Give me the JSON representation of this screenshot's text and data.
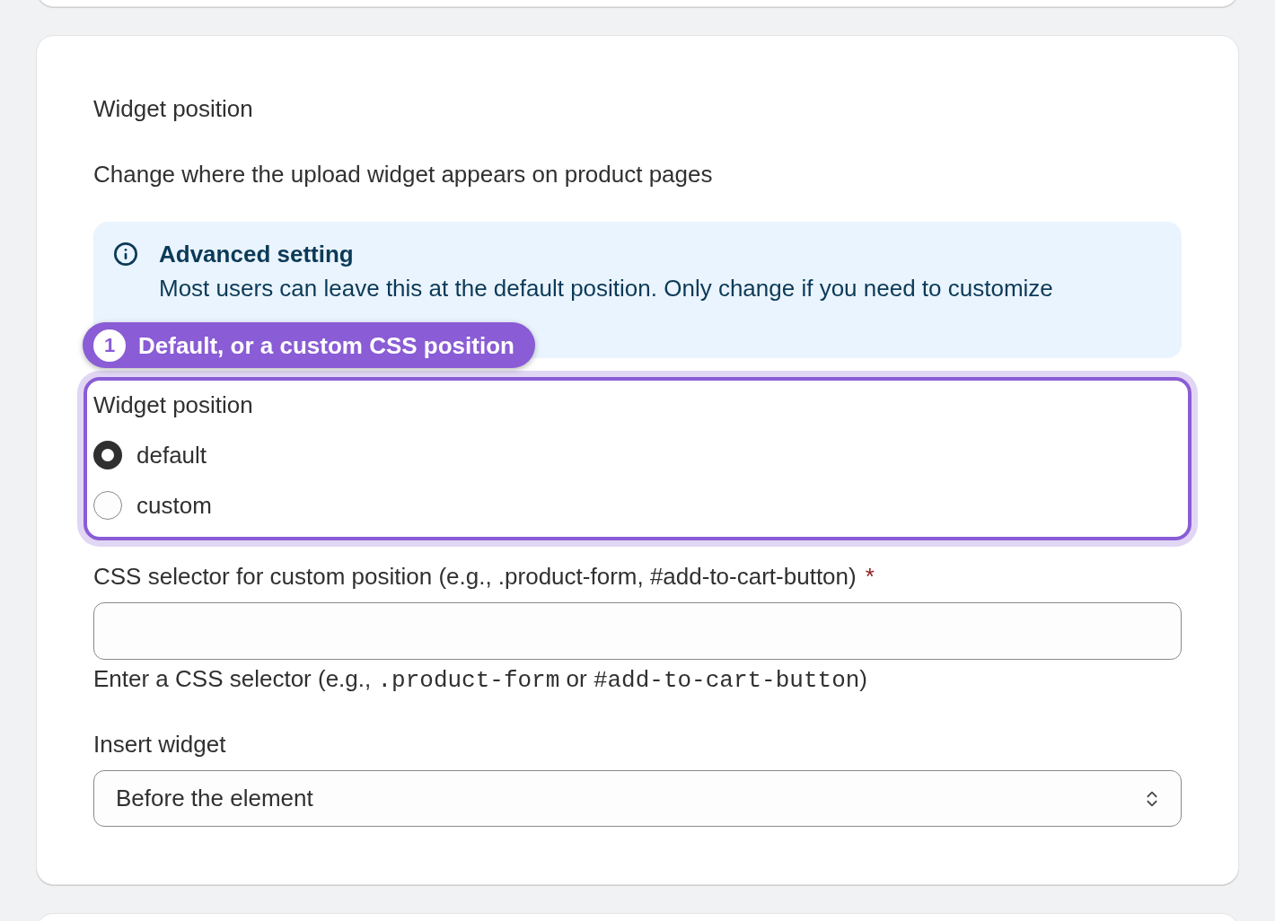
{
  "section": {
    "title": "Widget position",
    "description": "Change where the upload widget appears on product pages"
  },
  "banner": {
    "kind": "info",
    "title": "Advanced setting",
    "text": "Most users can leave this at the default position. Only change if you need to customize"
  },
  "callout": {
    "number": "1",
    "label": "Default, or a custom CSS position"
  },
  "radio_group": {
    "label": "Widget position",
    "options": [
      {
        "label": "default",
        "selected": true
      },
      {
        "label": "custom",
        "selected": false
      }
    ]
  },
  "selector_field": {
    "label": "CSS selector for custom position (e.g., .product-form, #add-to-cart-button)",
    "required_mark": "*",
    "help": [
      {
        "kind": "text",
        "text": "Enter a CSS selector (e.g., "
      },
      {
        "kind": "code",
        "text": ".product-form"
      },
      {
        "kind": "text",
        "text": " or "
      },
      {
        "kind": "code",
        "text": "#add-to-cart-button"
      },
      {
        "kind": "text",
        "text": ")"
      }
    ]
  },
  "insert_field": {
    "label": "Insert widget",
    "value": "Before the element"
  }
}
